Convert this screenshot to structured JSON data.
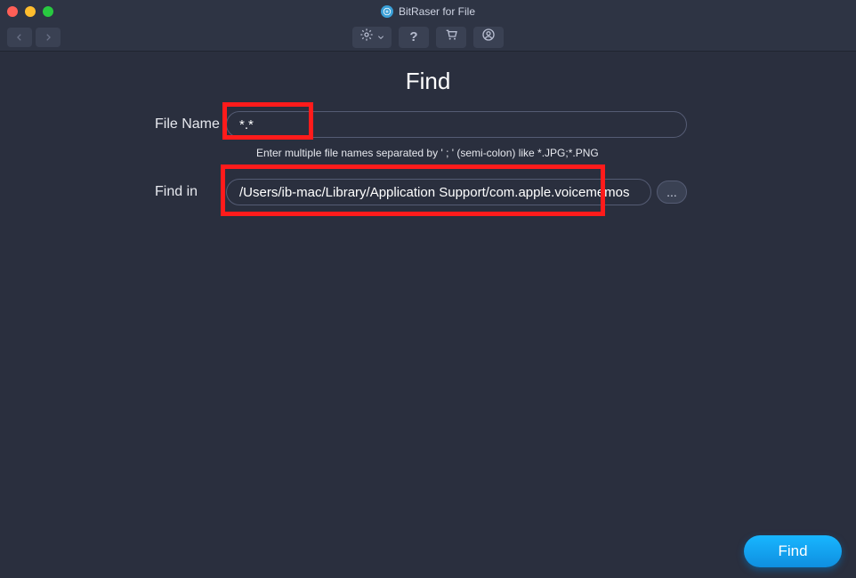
{
  "app": {
    "title": "BitRaser for File"
  },
  "page": {
    "title": "Find"
  },
  "fields": {
    "fileName": {
      "label": "File Name",
      "value": "*.*",
      "hint": "Enter multiple file names separated by ' ; ' (semi-colon) like *.JPG;*.PNG"
    },
    "findIn": {
      "label": "Find in",
      "value": "/Users/ib-mac/Library/Application Support/com.apple.voicememos",
      "browse": "..."
    }
  },
  "actions": {
    "find": "Find"
  }
}
